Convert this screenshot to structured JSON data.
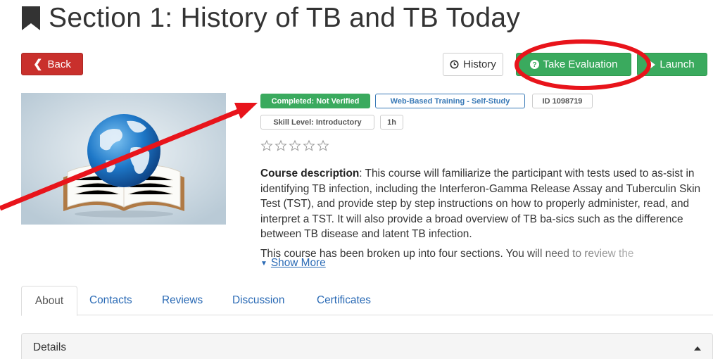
{
  "header": {
    "title": "Section 1: History of TB and TB Today",
    "icon": "bookmark-icon"
  },
  "toolbar": {
    "back_label": "Back",
    "history_label": "History",
    "evaluation_label": "Take Evaluation",
    "launch_label": "Launch"
  },
  "badges": {
    "status": "Completed: Not Verified",
    "type": "Web-Based Training - Self-Study",
    "id": "ID 1098719",
    "skill": "Skill Level: Introductory",
    "duration": "1h"
  },
  "rating": {
    "stars_filled": 0,
    "stars_total": 5
  },
  "description": {
    "heading": "Course description",
    "text": ": This course will familiarize the participant with tests used to as-sist in identifying TB infection, including the Interferon-Gamma Release Assay and Tuberculin Skin Test (TST), and provide step by step instructions on how to properly administer, read, and interpret a TST. It will also provide a broad overview of TB ba-sics such as the difference between TB disease and latent TB infection.",
    "more_text": "This course has been broken up into four sections. You will need to review the",
    "show_more": "Show More"
  },
  "tabs": [
    {
      "label": "About"
    },
    {
      "label": "Contacts"
    },
    {
      "label": "Reviews"
    },
    {
      "label": "Discussion"
    },
    {
      "label": "Certificates"
    }
  ],
  "details": {
    "title": "Details"
  },
  "colors": {
    "danger": "#c9302c",
    "success": "#3aaa5e",
    "link": "#2a6ab5",
    "annotation": "#e8141b"
  }
}
